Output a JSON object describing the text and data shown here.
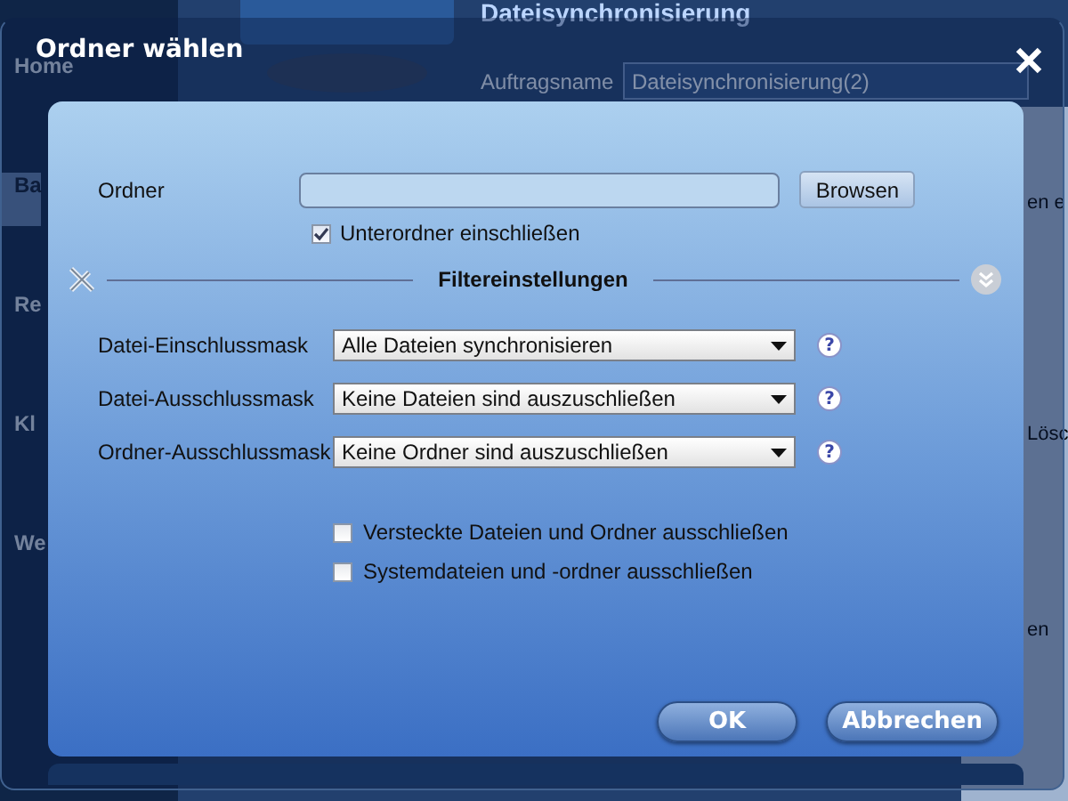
{
  "background": {
    "sidebar": [
      {
        "label": "Home",
        "selected": false
      },
      {
        "label": "Ba",
        "selected": true
      },
      {
        "label": "Re",
        "selected": false
      },
      {
        "label": "Kl",
        "selected": false
      },
      {
        "label": "We",
        "selected": false
      }
    ],
    "heading": "Dateisynchronisierung",
    "job_name_label": "Auftragsname",
    "job_name_value": "Dateisynchronisierung(2)",
    "edge_texts": [
      "en e",
      "Lösc",
      "en"
    ]
  },
  "dialog": {
    "title": "Ordner wählen",
    "folder_label": "Ordner",
    "browse_button": "Browsen",
    "include_subfolders": {
      "label": "Unterordner einschließen",
      "checked": true
    },
    "filter_title": "Filtereinstellungen",
    "filters": [
      {
        "label": "Datei-Einschlussmask",
        "value": "Alle Dateien synchronisieren",
        "help": "?"
      },
      {
        "label": "Datei-Ausschlussmask",
        "value": "Keine Dateien sind auszuschließen",
        "help": "?"
      },
      {
        "label": "Ordner-Ausschlussmask",
        "value": "Keine Ordner sind auszuschließen",
        "help": "?"
      }
    ],
    "exclude_options": [
      {
        "label": "Versteckte Dateien und Ordner ausschließen",
        "checked": false
      },
      {
        "label": "Systemdateien und -ordner ausschließen",
        "checked": false
      }
    ],
    "buttons": [
      "OK",
      "Abbrechen"
    ]
  }
}
